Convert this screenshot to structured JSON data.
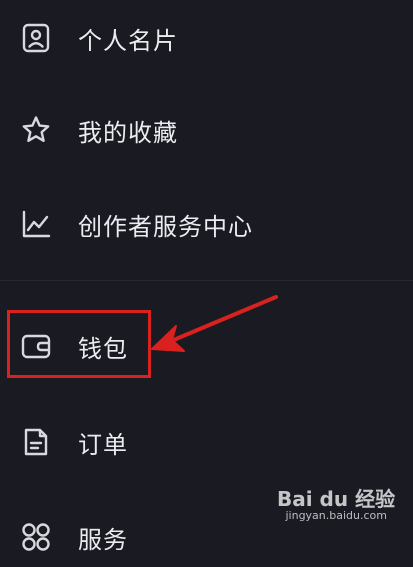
{
  "menu": {
    "items": [
      {
        "label": "个人名片",
        "icon": "id-card-icon"
      },
      {
        "label": "我的收藏",
        "icon": "star-icon"
      },
      {
        "label": "创作者服务中心",
        "icon": "line-chart-icon"
      },
      {
        "label": "钱包",
        "icon": "wallet-icon"
      },
      {
        "label": "订单",
        "icon": "document-icon"
      },
      {
        "label": "服务",
        "icon": "services-icon"
      }
    ]
  },
  "annotation": {
    "highlight_color": "#d9211f",
    "target": "钱包"
  },
  "watermark": {
    "logo_text": "Bai du 经验",
    "url": "jingyan.baidu.com"
  },
  "colors": {
    "background": "#1a1b22",
    "text": "#ececf0",
    "icon_stroke": "#d8d8de"
  }
}
